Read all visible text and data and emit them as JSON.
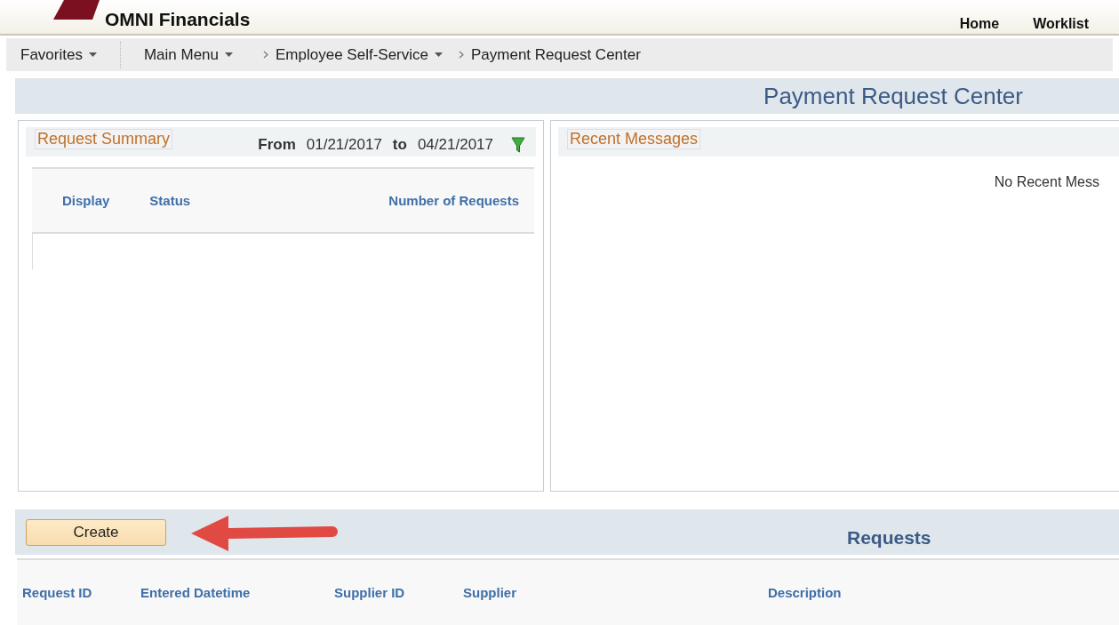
{
  "header": {
    "brand": "OMNI Financials",
    "links": [
      "Home",
      "Worklist"
    ]
  },
  "nav": {
    "menus": [
      {
        "label": "Favorites",
        "kind": "dropdown"
      },
      {
        "label": "Main Menu",
        "kind": "dropdown"
      }
    ],
    "breadcrumb": [
      {
        "label": "Employee Self-Service",
        "kind": "dropdown"
      },
      {
        "label": "Payment Request Center",
        "kind": "current"
      }
    ]
  },
  "page_title": "Payment Request Center",
  "request_summary": {
    "title": "Request Summary",
    "from_label": "From",
    "from_date": "01/21/2017",
    "to_label": "to",
    "to_date": "04/21/2017",
    "columns": [
      "Display",
      "Status",
      "Number of Requests"
    ]
  },
  "recent_messages": {
    "title": "Recent Messages",
    "empty_text": "No Recent Mess"
  },
  "requests": {
    "button": "Create",
    "title": "Requests",
    "columns": [
      "Request ID",
      "Entered Datetime",
      "Supplier ID",
      "Supplier",
      "Description"
    ]
  }
}
